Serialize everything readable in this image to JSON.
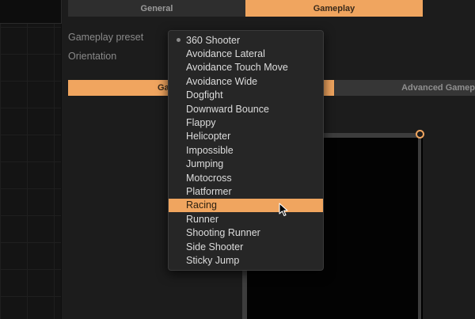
{
  "top_tabs": {
    "general": "General",
    "gameplay": "Gameplay"
  },
  "fields": {
    "gameplay_preset_label": "Gameplay preset",
    "orientation_label": "Orientation"
  },
  "sub_tabs": {
    "active": "Ga",
    "inactive": "Advanced Gamep"
  },
  "dropdown": {
    "selected": "360 Shooter",
    "highlighted": "Racing",
    "items": [
      "360 Shooter",
      "Avoidance Lateral",
      "Avoidance Touch Move",
      "Avoidance Wide",
      "Dogfight",
      "Downward Bounce",
      "Flappy",
      "Helicopter",
      "Impossible",
      "Jumping",
      "Motocross",
      "Platformer",
      "Racing",
      "Runner",
      "Shooting Runner",
      "Side Shooter",
      "Sticky Jump"
    ]
  },
  "colors": {
    "accent": "#f0a55f",
    "background": "#1c1c1c",
    "menu_bg": "#262626"
  }
}
